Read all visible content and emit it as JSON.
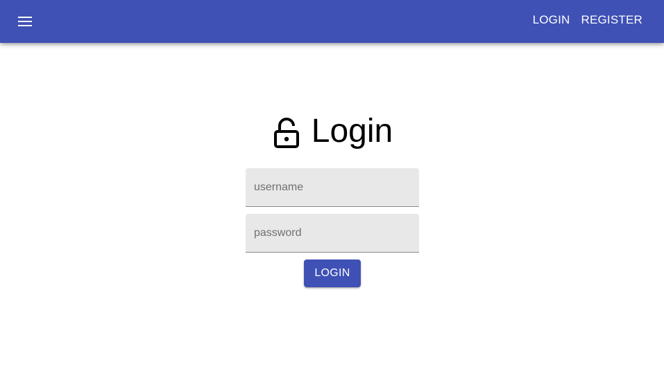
{
  "app_bar": {
    "menu_icon": "hamburger-menu-icon",
    "nav": {
      "login_label": "LOGIN",
      "register_label": "REGISTER"
    },
    "color": "#3f51b5"
  },
  "login_form": {
    "title": "Login",
    "title_icon": "lock-open-icon",
    "username_placeholder": "username",
    "password_placeholder": "password",
    "submit_label": "LOGIN"
  }
}
